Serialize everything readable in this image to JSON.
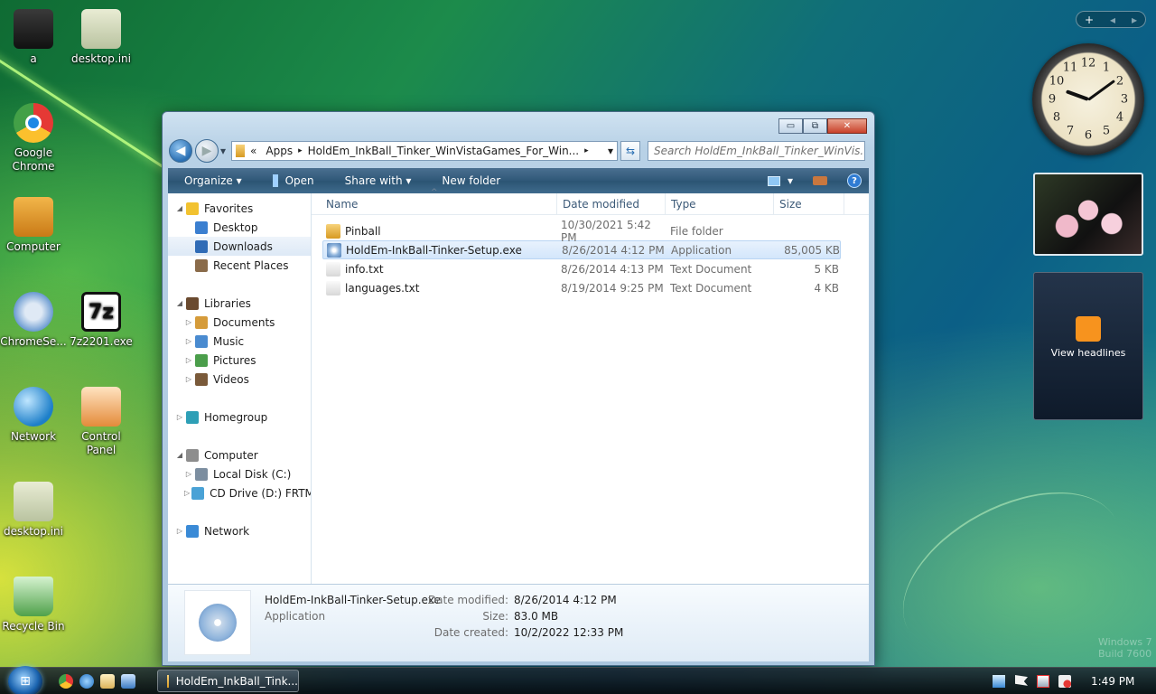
{
  "desktop": {
    "icons": [
      {
        "label": "a"
      },
      {
        "label": "desktop.ini"
      },
      {
        "label": "Google Chrome"
      },
      {
        "label": "Computer"
      },
      {
        "label": "ChromeSe..."
      },
      {
        "label": "7z2201.exe",
        "glyph": "7z"
      },
      {
        "label": "Network"
      },
      {
        "label": "Control Panel"
      },
      {
        "label": "desktop.ini"
      },
      {
        "label": "Recycle Bin"
      }
    ]
  },
  "gadgets": {
    "toolbar": {
      "add": "+",
      "prev": "◂",
      "next": "▸"
    },
    "clock": {
      "numbers": [
        "12",
        "1",
        "2",
        "3",
        "4",
        "5",
        "6",
        "7",
        "8",
        "9",
        "10",
        "11"
      ]
    },
    "feed": {
      "label": "View headlines"
    }
  },
  "window": {
    "caption": {
      "minimize": "▭",
      "maximize": "⧉",
      "close": "✕"
    },
    "nav": {
      "back": "◀",
      "forward": "▶",
      "recent": "▾"
    },
    "address": {
      "chevrons": "«",
      "crumbs": [
        "Apps",
        "HoldEm_InkBall_Tinker_WinVistaGames_For_Win..."
      ],
      "sep": "▸",
      "dropdown": "▾",
      "refresh": "⇆"
    },
    "search": {
      "placeholder": "Search HoldEm_InkBall_Tinker_WinVis...",
      "icon": "⌕"
    },
    "toolbar": {
      "organize": "Organize ▾",
      "open": "Open",
      "share_with": "Share with ▾",
      "new_folder": "New folder",
      "views": "▾",
      "help": "?"
    },
    "navpane": [
      {
        "label": "Favorites",
        "level": 0,
        "twisty": "◢"
      },
      {
        "label": "Desktop",
        "level": 1
      },
      {
        "label": "Downloads",
        "level": 1,
        "selected": true
      },
      {
        "label": "Recent Places",
        "level": 1
      },
      {
        "label": "",
        "spacer": true
      },
      {
        "label": "Libraries",
        "level": 0,
        "twisty": "◢"
      },
      {
        "label": "Documents",
        "level": 1,
        "twisty": "▷"
      },
      {
        "label": "Music",
        "level": 1,
        "twisty": "▷"
      },
      {
        "label": "Pictures",
        "level": 1,
        "twisty": "▷"
      },
      {
        "label": "Videos",
        "level": 1,
        "twisty": "▷"
      },
      {
        "label": "",
        "spacer": true
      },
      {
        "label": "Homegroup",
        "level": 0,
        "twisty": "▷"
      },
      {
        "label": "",
        "spacer": true
      },
      {
        "label": "Computer",
        "level": 0,
        "twisty": "◢"
      },
      {
        "label": "Local Disk (C:)",
        "level": 1,
        "twisty": "▷"
      },
      {
        "label": "CD Drive (D:) FRTME",
        "level": 1,
        "twisty": "▷"
      },
      {
        "label": "",
        "spacer": true
      },
      {
        "label": "Network",
        "level": 0,
        "twisty": "▷"
      }
    ],
    "columns": [
      "Name",
      "Date modified",
      "Type",
      "Size"
    ],
    "sort_indicator": "^",
    "files": [
      {
        "name": "Pinball",
        "date": "10/30/2021 5:42 PM",
        "type": "File folder",
        "size": "",
        "kind": "folder"
      },
      {
        "name": "HoldEm-InkBall-Tinker-Setup.exe",
        "date": "8/26/2014 4:12 PM",
        "type": "Application",
        "size": "85,005 KB",
        "kind": "app",
        "selected": true
      },
      {
        "name": "info.txt",
        "date": "8/26/2014 4:13 PM",
        "type": "Text Document",
        "size": "5 KB",
        "kind": "txt"
      },
      {
        "name": "languages.txt",
        "date": "8/19/2014 9:25 PM",
        "type": "Text Document",
        "size": "4 KB",
        "kind": "txt"
      }
    ],
    "details": {
      "name": "HoldEm-InkBall-Tinker-Setup.exe",
      "type": "Application",
      "date_modified_label": "Date modified:",
      "date_modified": "8/26/2014 4:12 PM",
      "size_label": "Size:",
      "size": "83.0 MB",
      "date_created_label": "Date created:",
      "date_created": "10/2/2022 12:33 PM"
    }
  },
  "taskbar": {
    "start": "⊞",
    "active_task": "HoldEm_InkBall_Tink...",
    "time": "1:49 PM"
  },
  "watermark": {
    "line1": "Windows 7",
    "line2": "Build 7600"
  },
  "colors": {
    "accent": "#2a6fb3",
    "selection": "#d3e6fb"
  }
}
